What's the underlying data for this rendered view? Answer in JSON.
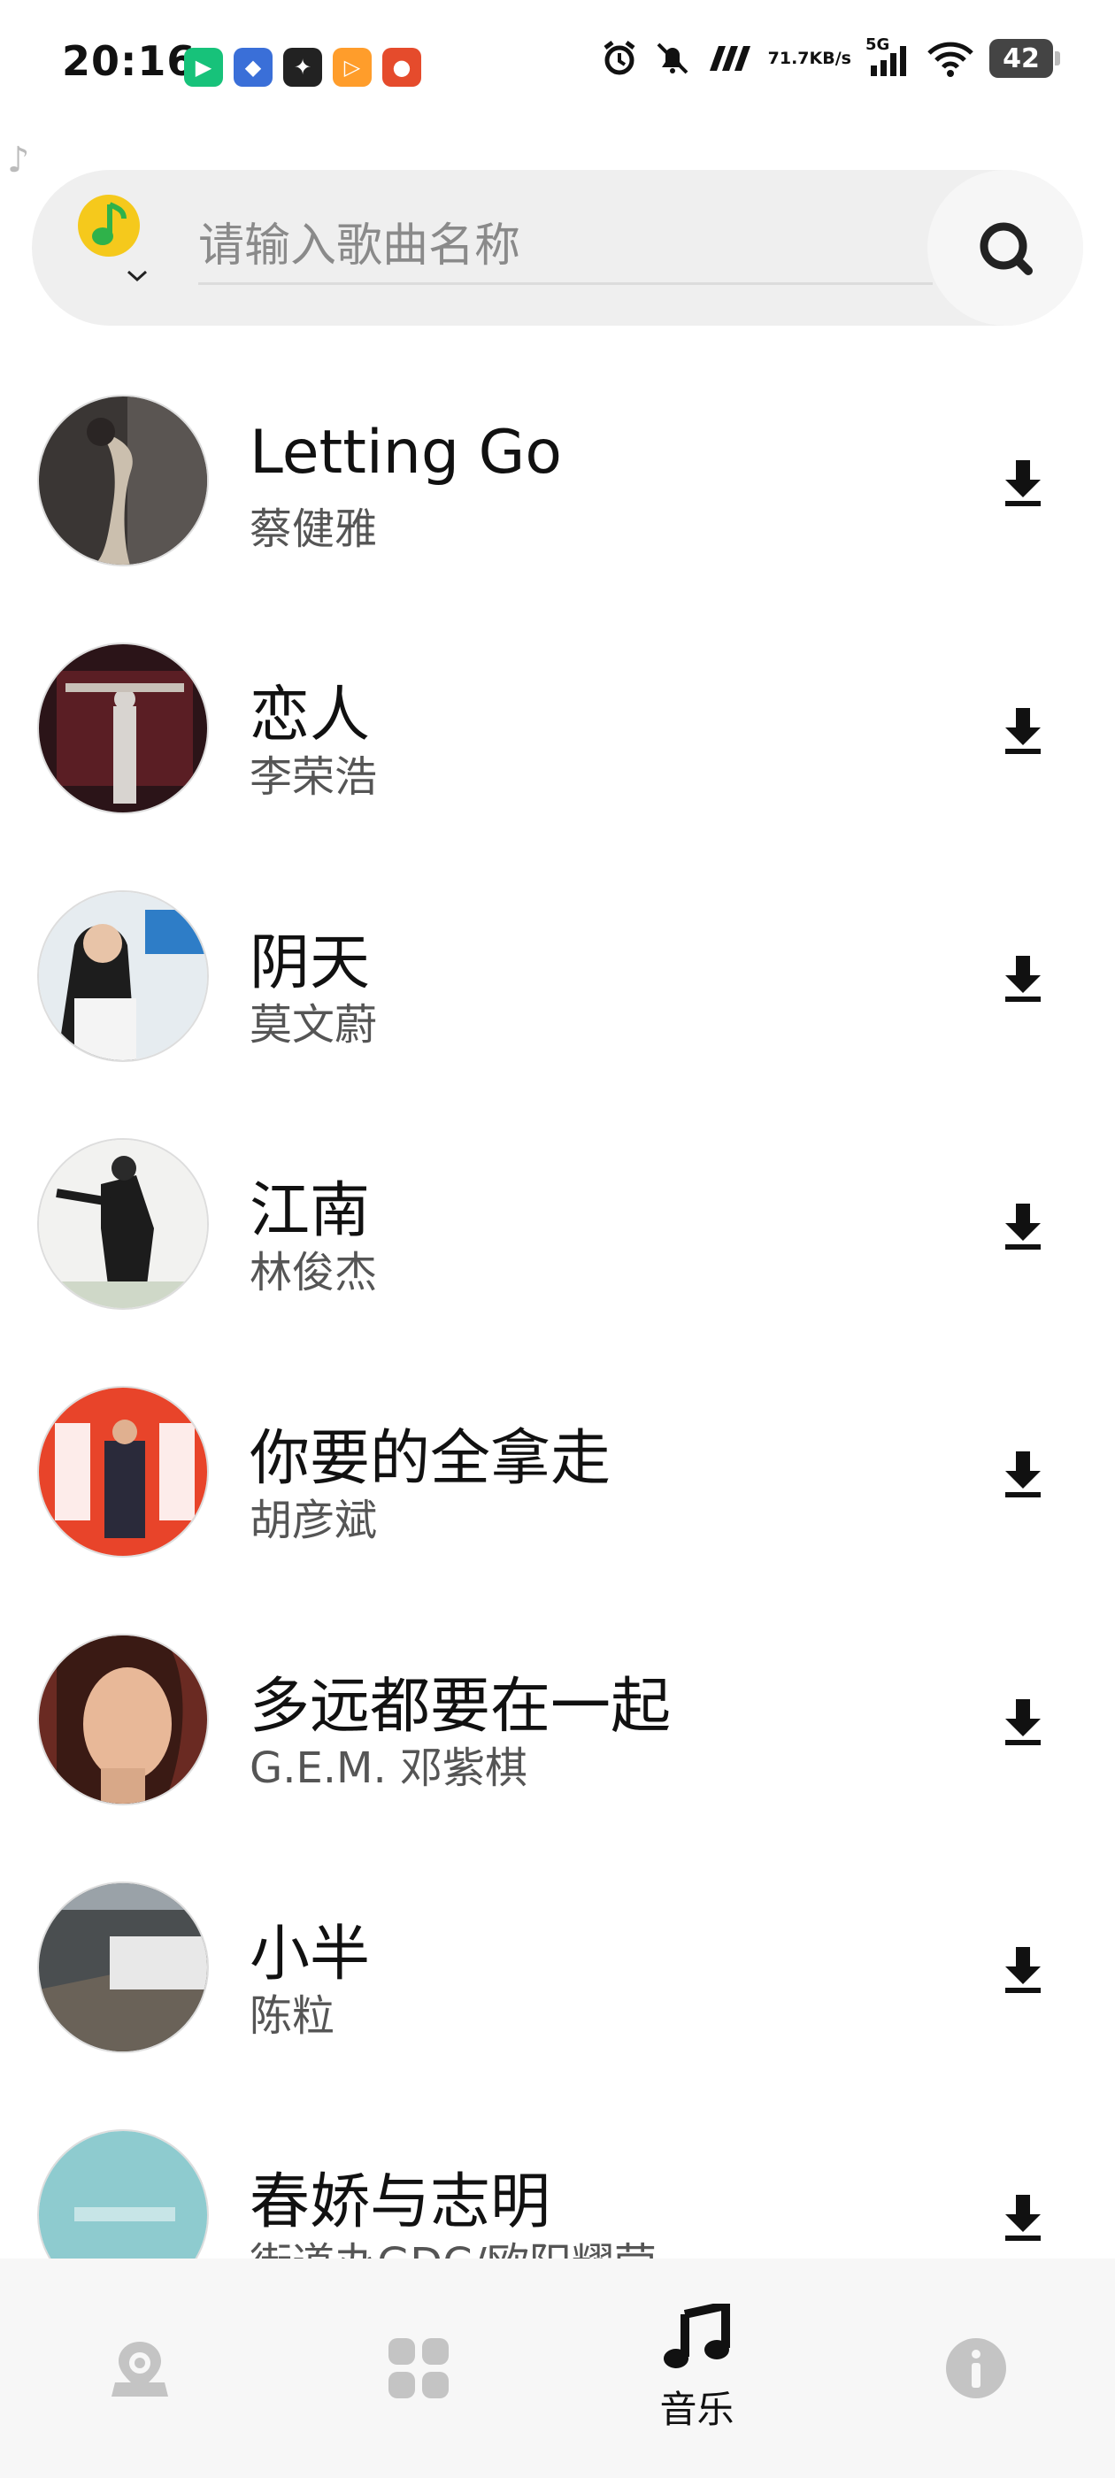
{
  "status_bar": {
    "time": "20:16",
    "net_speed_value": "71.7",
    "net_speed_unit": "KB/s",
    "network": "5G",
    "battery": "42"
  },
  "search": {
    "placeholder": "请输入歌曲名称"
  },
  "songs": [
    {
      "title": "Letting Go",
      "artist": "蔡健雅"
    },
    {
      "title": "恋人",
      "artist": "李荣浩"
    },
    {
      "title": "阴天",
      "artist": "莫文蔚"
    },
    {
      "title": "江南",
      "artist": "林俊杰"
    },
    {
      "title": "你要的全拿走",
      "artist": "胡彦斌"
    },
    {
      "title": "多远都要在一起",
      "artist": "G.E.M. 邓紫棋"
    },
    {
      "title": "小半",
      "artist": "陈粒"
    },
    {
      "title": "春娇与志明",
      "artist": "街道办GDC/欧阳耀莹"
    }
  ],
  "bottom_nav": {
    "active_label": "音乐"
  },
  "colors": {
    "search_bg": "#efefef",
    "nav_bg": "#f7f7f7",
    "inactive_icon": "#c4c4c4",
    "active_icon": "#111111",
    "logo_yellow": "#f5c91c",
    "logo_green": "#2fb24a"
  }
}
